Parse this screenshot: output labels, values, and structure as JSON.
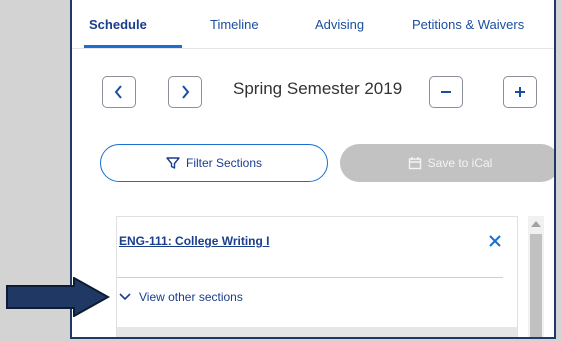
{
  "tabs": [
    {
      "label": "Schedule"
    },
    {
      "label": "Timeline"
    },
    {
      "label": "Advising"
    },
    {
      "label": "Petitions & Waivers"
    }
  ],
  "term": {
    "label": "Spring Semester 2019"
  },
  "actions": {
    "filter_label": "Filter Sections",
    "ical_label": "Save to iCal"
  },
  "course": {
    "title": "ENG-111: College Writing I",
    "view_other_label": "View other sections"
  },
  "icons": {
    "previous": "chevron-left-icon",
    "next": "chevron-right-icon",
    "remove": "minus-icon",
    "add": "plus-icon",
    "filter": "filter-icon",
    "calendar": "calendar-icon",
    "close": "close-icon",
    "expand": "chevron-down-icon",
    "pointer": "arrow-right-icon"
  },
  "colors": {
    "accent": "#1a6fd1",
    "link": "#1a3d8c",
    "pointer_arrow": "#1f3864",
    "disabled_button": "#c2c2c2"
  }
}
